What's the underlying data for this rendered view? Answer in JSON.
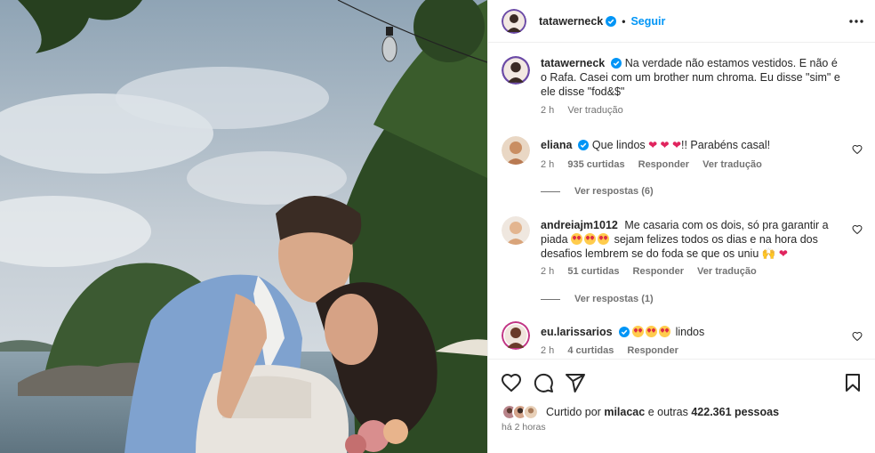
{
  "post": {
    "username": "tatawerneck",
    "separator": "•",
    "follow_label": "Seguir",
    "more_icon": "more-options-icon"
  },
  "caption": {
    "username": "tatawerneck",
    "text": "Na verdade não estamos vestidos. E não é o Rafa. Casei com um brother num chroma. Eu disse \"sim\" e ele disse \"fod&$\"",
    "time": "2 h",
    "translate": "Ver tradução"
  },
  "comments": [
    {
      "username": "eliana",
      "text_a": "Que lindos",
      "text_b": "!! Parabéns casal!",
      "time": "2 h",
      "likes": "935 curtidas",
      "reply": "Responder",
      "translate": "Ver tradução",
      "view_replies": "Ver respostas (6)"
    },
    {
      "username": "andreiajm1012",
      "text_a": "Me casaria com os dois, só pra garantir a piada",
      "text_b": "sejam felizes todos os dias e na hora dos desafios lembrem se do foda se que os uniu 🙌",
      "time": "2 h",
      "likes": "51 curtidas",
      "reply": "Responder",
      "translate": "Ver tradução",
      "view_replies": "Ver respostas (1)"
    },
    {
      "username": "eu.larissarios",
      "text_a": "lindos",
      "time": "2 h",
      "likes": "4 curtidas",
      "reply": "Responder"
    }
  ],
  "likes": {
    "prefix": "Curtido por",
    "user": "milacac",
    "suffix": "e outras",
    "count": "422.361 pessoas",
    "time": "há 2 horas"
  },
  "colors": {
    "accent": "#0095f6",
    "text": "#262626",
    "muted": "#737373",
    "verified": "#0095f6",
    "heart": "#e0245e"
  }
}
